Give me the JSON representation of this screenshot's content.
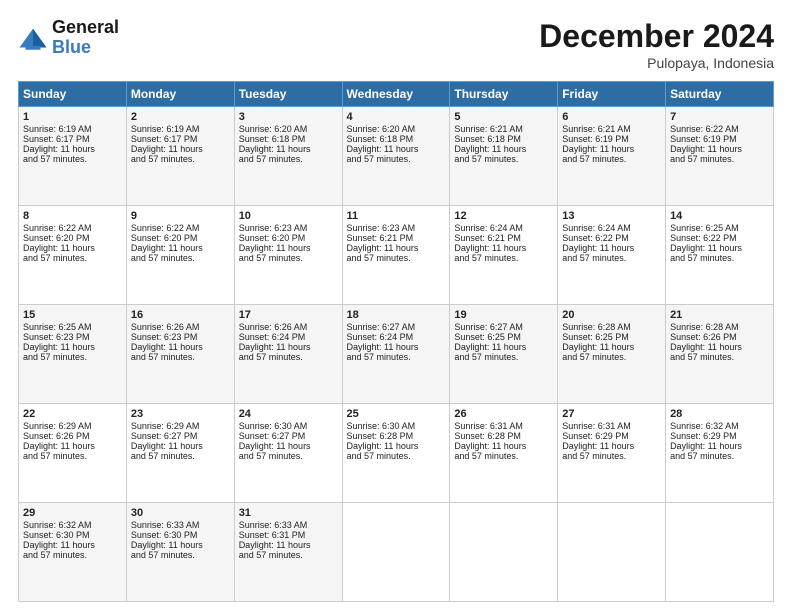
{
  "header": {
    "logo": {
      "general": "General",
      "blue": "Blue"
    },
    "title": "December 2024",
    "subtitle": "Pulopaya, Indonesia"
  },
  "days_of_week": [
    "Sunday",
    "Monday",
    "Tuesday",
    "Wednesday",
    "Thursday",
    "Friday",
    "Saturday"
  ],
  "weeks": [
    [
      {
        "day": 1,
        "info": "Sunrise: 6:19 AM\nSunset: 6:17 PM\nDaylight: 11 hours\nand 57 minutes."
      },
      {
        "day": 2,
        "info": "Sunrise: 6:19 AM\nSunset: 6:17 PM\nDaylight: 11 hours\nand 57 minutes."
      },
      {
        "day": 3,
        "info": "Sunrise: 6:20 AM\nSunset: 6:18 PM\nDaylight: 11 hours\nand 57 minutes."
      },
      {
        "day": 4,
        "info": "Sunrise: 6:20 AM\nSunset: 6:18 PM\nDaylight: 11 hours\nand 57 minutes."
      },
      {
        "day": 5,
        "info": "Sunrise: 6:21 AM\nSunset: 6:18 PM\nDaylight: 11 hours\nand 57 minutes."
      },
      {
        "day": 6,
        "info": "Sunrise: 6:21 AM\nSunset: 6:19 PM\nDaylight: 11 hours\nand 57 minutes."
      },
      {
        "day": 7,
        "info": "Sunrise: 6:22 AM\nSunset: 6:19 PM\nDaylight: 11 hours\nand 57 minutes."
      }
    ],
    [
      {
        "day": 8,
        "info": "Sunrise: 6:22 AM\nSunset: 6:20 PM\nDaylight: 11 hours\nand 57 minutes."
      },
      {
        "day": 9,
        "info": "Sunrise: 6:22 AM\nSunset: 6:20 PM\nDaylight: 11 hours\nand 57 minutes."
      },
      {
        "day": 10,
        "info": "Sunrise: 6:23 AM\nSunset: 6:20 PM\nDaylight: 11 hours\nand 57 minutes."
      },
      {
        "day": 11,
        "info": "Sunrise: 6:23 AM\nSunset: 6:21 PM\nDaylight: 11 hours\nand 57 minutes."
      },
      {
        "day": 12,
        "info": "Sunrise: 6:24 AM\nSunset: 6:21 PM\nDaylight: 11 hours\nand 57 minutes."
      },
      {
        "day": 13,
        "info": "Sunrise: 6:24 AM\nSunset: 6:22 PM\nDaylight: 11 hours\nand 57 minutes."
      },
      {
        "day": 14,
        "info": "Sunrise: 6:25 AM\nSunset: 6:22 PM\nDaylight: 11 hours\nand 57 minutes."
      }
    ],
    [
      {
        "day": 15,
        "info": "Sunrise: 6:25 AM\nSunset: 6:23 PM\nDaylight: 11 hours\nand 57 minutes."
      },
      {
        "day": 16,
        "info": "Sunrise: 6:26 AM\nSunset: 6:23 PM\nDaylight: 11 hours\nand 57 minutes."
      },
      {
        "day": 17,
        "info": "Sunrise: 6:26 AM\nSunset: 6:24 PM\nDaylight: 11 hours\nand 57 minutes."
      },
      {
        "day": 18,
        "info": "Sunrise: 6:27 AM\nSunset: 6:24 PM\nDaylight: 11 hours\nand 57 minutes."
      },
      {
        "day": 19,
        "info": "Sunrise: 6:27 AM\nSunset: 6:25 PM\nDaylight: 11 hours\nand 57 minutes."
      },
      {
        "day": 20,
        "info": "Sunrise: 6:28 AM\nSunset: 6:25 PM\nDaylight: 11 hours\nand 57 minutes."
      },
      {
        "day": 21,
        "info": "Sunrise: 6:28 AM\nSunset: 6:26 PM\nDaylight: 11 hours\nand 57 minutes."
      }
    ],
    [
      {
        "day": 22,
        "info": "Sunrise: 6:29 AM\nSunset: 6:26 PM\nDaylight: 11 hours\nand 57 minutes."
      },
      {
        "day": 23,
        "info": "Sunrise: 6:29 AM\nSunset: 6:27 PM\nDaylight: 11 hours\nand 57 minutes."
      },
      {
        "day": 24,
        "info": "Sunrise: 6:30 AM\nSunset: 6:27 PM\nDaylight: 11 hours\nand 57 minutes."
      },
      {
        "day": 25,
        "info": "Sunrise: 6:30 AM\nSunset: 6:28 PM\nDaylight: 11 hours\nand 57 minutes."
      },
      {
        "day": 26,
        "info": "Sunrise: 6:31 AM\nSunset: 6:28 PM\nDaylight: 11 hours\nand 57 minutes."
      },
      {
        "day": 27,
        "info": "Sunrise: 6:31 AM\nSunset: 6:29 PM\nDaylight: 11 hours\nand 57 minutes."
      },
      {
        "day": 28,
        "info": "Sunrise: 6:32 AM\nSunset: 6:29 PM\nDaylight: 11 hours\nand 57 minutes."
      }
    ],
    [
      {
        "day": 29,
        "info": "Sunrise: 6:32 AM\nSunset: 6:30 PM\nDaylight: 11 hours\nand 57 minutes."
      },
      {
        "day": 30,
        "info": "Sunrise: 6:33 AM\nSunset: 6:30 PM\nDaylight: 11 hours\nand 57 minutes."
      },
      {
        "day": 31,
        "info": "Sunrise: 6:33 AM\nSunset: 6:31 PM\nDaylight: 11 hours\nand 57 minutes."
      },
      null,
      null,
      null,
      null
    ]
  ]
}
